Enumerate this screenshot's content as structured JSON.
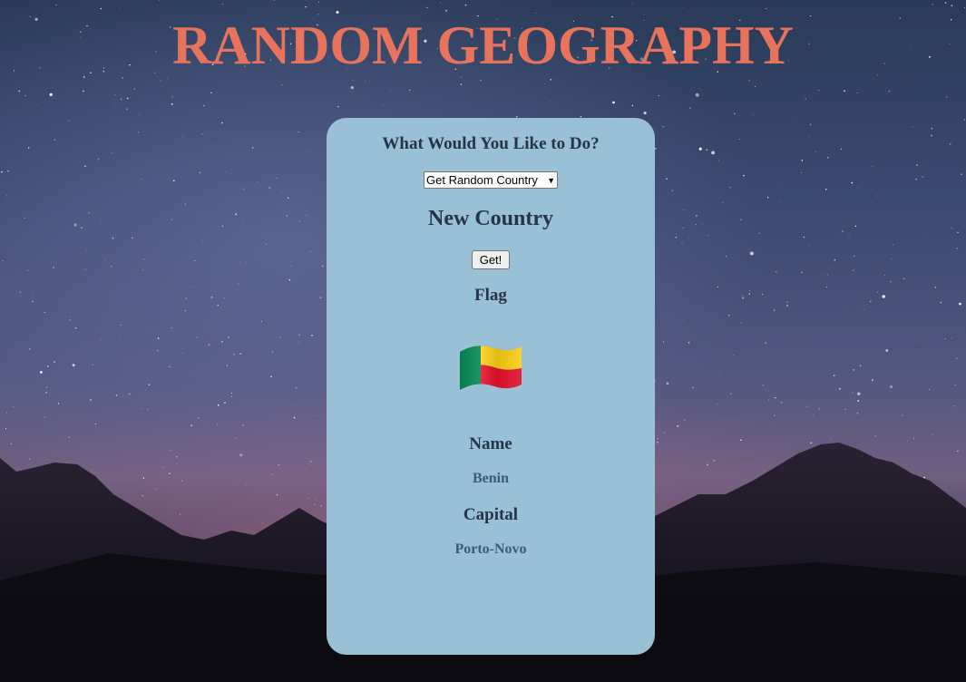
{
  "title": "RANDOM GEOGRAPHY",
  "colors": {
    "title": "#e8735c",
    "card_background": "#99c0d5",
    "heading_text": "#263445",
    "value_text": "#3d5a78"
  },
  "card": {
    "question": "What Would You Like to Do?",
    "action_select": {
      "selected": "Get Random Country"
    },
    "section_heading": "New Country",
    "get_button_label": "Get!",
    "flag_heading": "Flag",
    "flag_icon": "benin-flag-icon",
    "name_heading": "Name",
    "name_value": "Benin",
    "capital_heading": "Capital",
    "capital_value": "Porto-Novo"
  }
}
